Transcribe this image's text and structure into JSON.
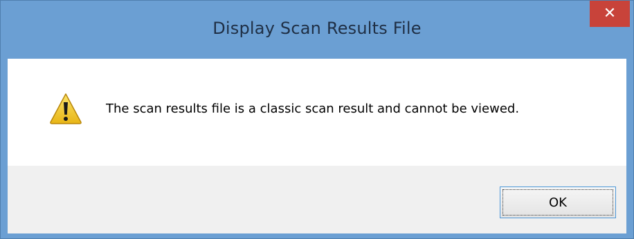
{
  "window": {
    "title": "Display Scan Results File",
    "close_glyph": "✕"
  },
  "message": {
    "icon": "warning-icon",
    "text": "The scan results file is a classic scan result and cannot be viewed."
  },
  "buttons": {
    "ok_label": "OK"
  },
  "colors": {
    "titlebar": "#6b9fd3",
    "close": "#c8433a",
    "button_border": "#4c97d8",
    "footer": "#f0f0f0"
  }
}
